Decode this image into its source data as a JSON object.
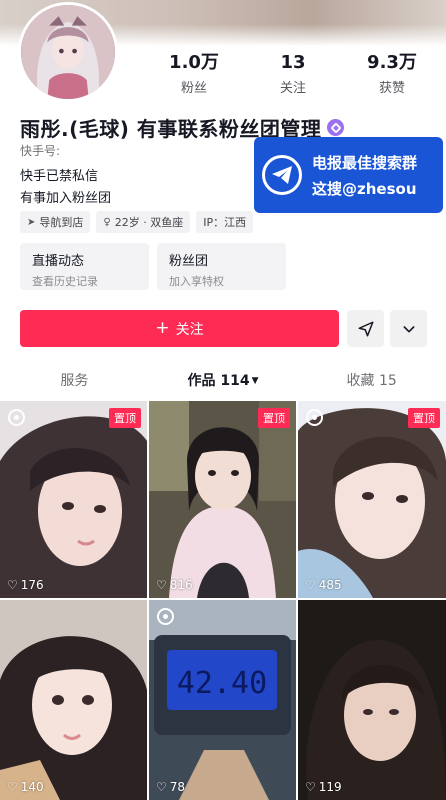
{
  "profile": {
    "stats": [
      {
        "num": "1.0万",
        "label": "粉丝"
      },
      {
        "num": "13",
        "label": "关注"
      },
      {
        "num": "9.3万",
        "label": "获赞"
      }
    ],
    "name": "雨彤.(毛球) 有事联系粉丝团管理",
    "kuaishou_id_label": "快手号:",
    "bio_line1": "快手已禁私信",
    "bio_line2": "有事加入粉丝团",
    "tags": [
      {
        "icon": "navigation-icon",
        "text": "导航到店"
      },
      {
        "icon": "gender-icon",
        "text": "22岁 · 双鱼座"
      },
      {
        "icon": "",
        "text": "IP：江西"
      }
    ]
  },
  "cards": [
    {
      "title": "直播动态",
      "sub": "查看历史记录"
    },
    {
      "title": "粉丝团",
      "sub": "加入享特权"
    }
  ],
  "actions": {
    "follow_label": "关注",
    "accent": "#fe2c55"
  },
  "watermark": {
    "line1": "电报最佳搜索群",
    "line2": "这搜@zhesou",
    "color": "#1a55d6"
  },
  "tabs": [
    {
      "label": "服务",
      "active": false
    },
    {
      "label": "作品 114",
      "active": true
    },
    {
      "label": "收藏 15",
      "active": false
    }
  ],
  "grid": [
    {
      "likes": "176",
      "pinned": true,
      "pin_label": "置顶",
      "live": true
    },
    {
      "likes": "816",
      "pinned": true,
      "pin_label": "置顶",
      "live": false
    },
    {
      "likes": "485",
      "pinned": true,
      "pin_label": "置顶",
      "live": true
    },
    {
      "likes": "140",
      "pinned": false,
      "live": false
    },
    {
      "likes": "78",
      "pinned": false,
      "live": true
    },
    {
      "likes": "119",
      "pinned": false,
      "live": false
    }
  ]
}
